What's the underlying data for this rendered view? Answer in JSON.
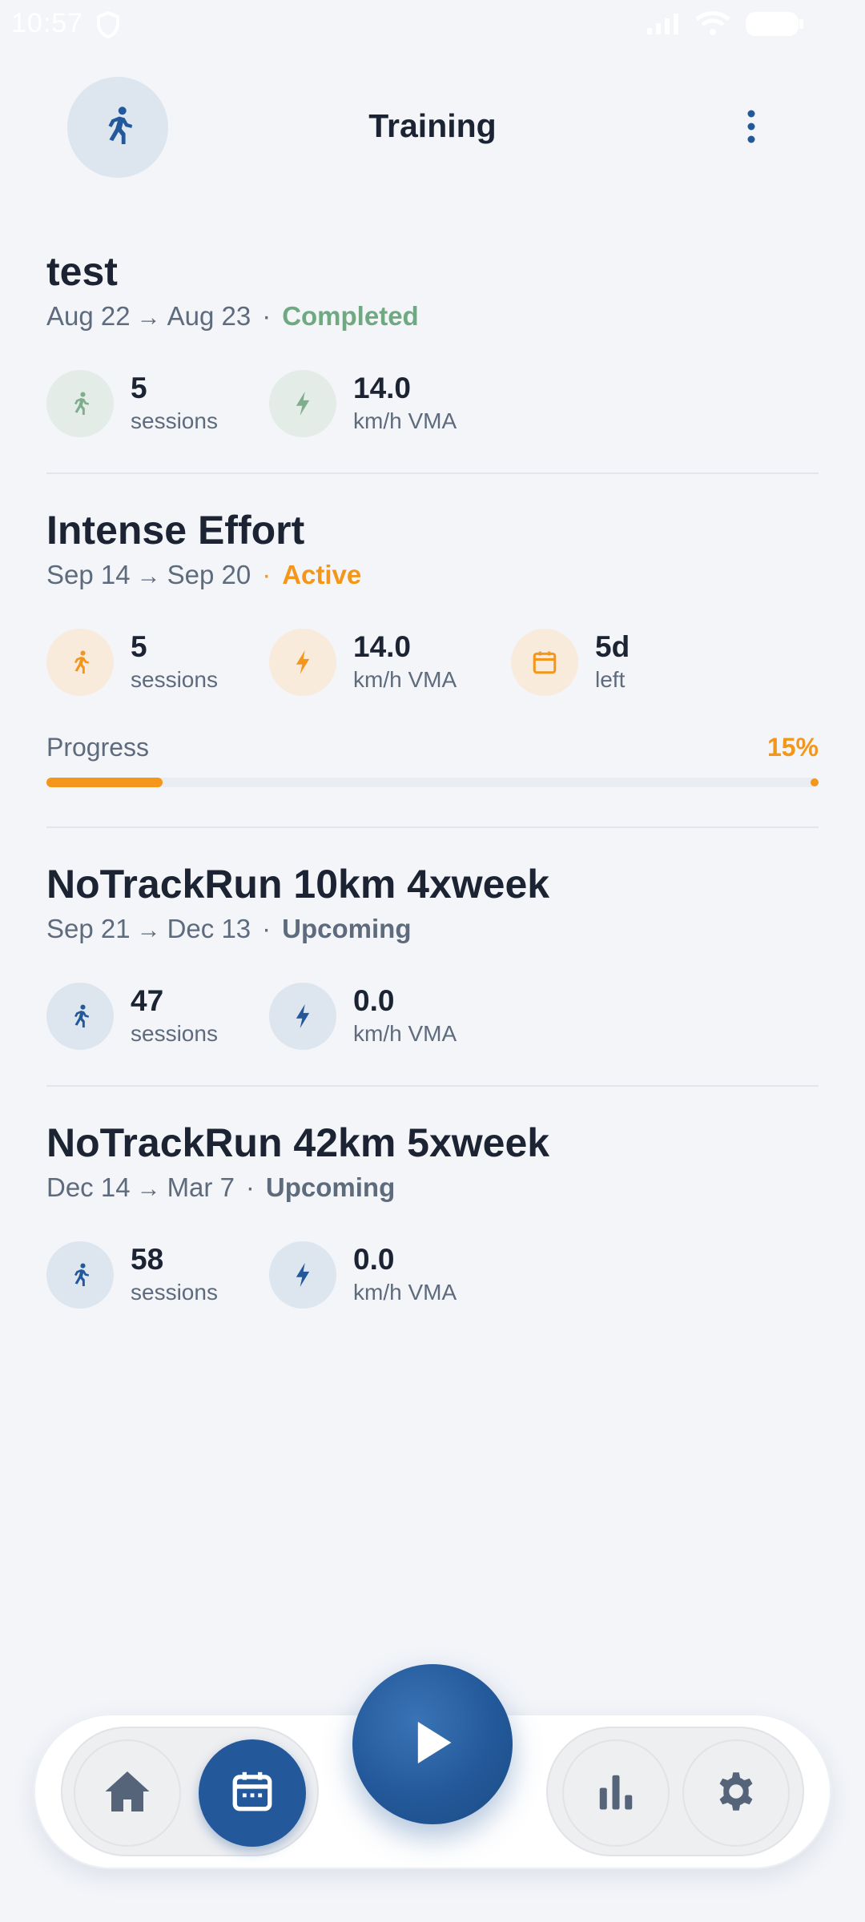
{
  "status_bar": {
    "time": "10:57"
  },
  "header": {
    "title": "Training",
    "avatar_icon": "runner-icon",
    "menu_icon": "more-vertical-icon"
  },
  "plans": [
    {
      "title": "test",
      "start": "Aug 22",
      "end": "Aug 23",
      "status": "Completed",
      "stats": [
        {
          "value": "5",
          "label": "sessions",
          "icon": "runner-icon"
        },
        {
          "value": "14.0",
          "label": "km/h VMA",
          "icon": "bolt-icon"
        }
      ]
    },
    {
      "title": "Intense Effort",
      "start": "Sep 14",
      "end": "Sep 20",
      "status": "Active",
      "stats": [
        {
          "value": "5",
          "label": "sessions",
          "icon": "runner-icon"
        },
        {
          "value": "14.0",
          "label": "km/h VMA",
          "icon": "bolt-icon"
        },
        {
          "value": "5d",
          "label": "left",
          "icon": "calendar-icon"
        }
      ],
      "progress": {
        "label": "Progress",
        "percent_text": "15%",
        "fraction": 0.15
      }
    },
    {
      "title": "NoTrackRun 10km 4xweek",
      "start": "Sep 21",
      "end": "Dec 13",
      "status": "Upcoming",
      "stats": [
        {
          "value": "47",
          "label": "sessions",
          "icon": "runner-icon"
        },
        {
          "value": "0.0",
          "label": "km/h VMA",
          "icon": "bolt-icon"
        }
      ]
    },
    {
      "title": "NoTrackRun 42km 5xweek",
      "start": "Dec 14",
      "end": "Mar 7",
      "status": "Upcoming",
      "stats": [
        {
          "value": "58",
          "label": "sessions",
          "icon": "runner-icon"
        },
        {
          "value": "0.0",
          "label": "km/h VMA",
          "icon": "bolt-icon"
        }
      ]
    }
  ],
  "separators": {
    "arrow": "→",
    "dot": "·"
  },
  "nav": {
    "items": [
      "home-icon",
      "calendar-icon",
      "play-icon",
      "bar-chart-icon",
      "settings-icon"
    ],
    "active": "calendar-icon"
  },
  "colors": {
    "accent": "#23599a",
    "completed": "#6fa982",
    "active": "#f3961a",
    "muted": "#5e6b7d",
    "background": "#f3f5f9"
  }
}
